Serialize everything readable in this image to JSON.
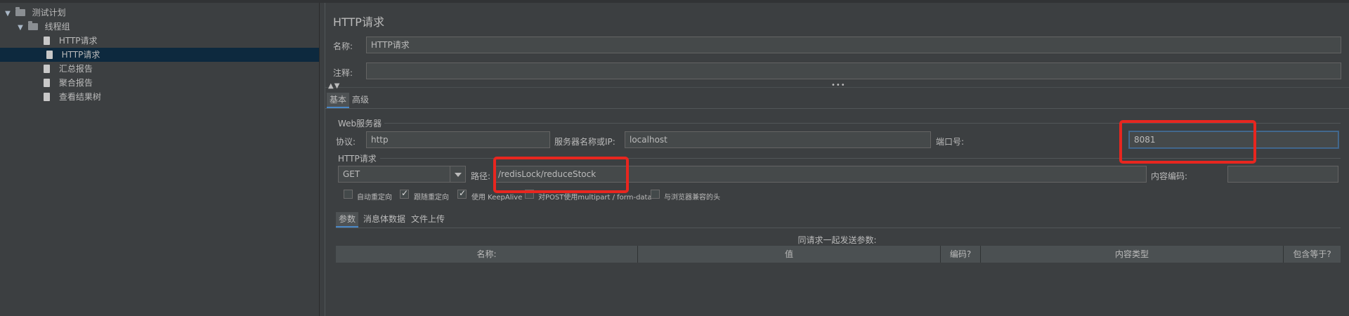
{
  "tree": {
    "items": [
      {
        "label": "测试计划"
      },
      {
        "label": "线程组"
      },
      {
        "label": "HTTP请求"
      },
      {
        "label": "HTTP请求"
      },
      {
        "label": "汇总报告"
      },
      {
        "label": "聚合报告"
      },
      {
        "label": "查看结果树"
      }
    ]
  },
  "panel": {
    "title": "HTTP请求",
    "name_label": "名称:",
    "name_value": "HTTP请求",
    "comment_label": "注释:",
    "comment_value": "",
    "tabs": [
      {
        "label": "基本"
      },
      {
        "label": "高级"
      }
    ]
  },
  "web_server": {
    "group_label": "Web服务器",
    "protocol_label": "协议:",
    "protocol_value": "http",
    "server_label": "服务器名称或IP:",
    "server_value": "localhost",
    "port_label": "端口号:",
    "port_value": "8081"
  },
  "http_request": {
    "group_label": "HTTP请求",
    "method_value": "GET",
    "path_label": "路径:",
    "path_value": "/redisLock/reduceStock",
    "encoding_label": "内容编码:",
    "encoding_value": "",
    "options": [
      {
        "label": "自动重定向",
        "checked": false
      },
      {
        "label": "跟随重定向",
        "checked": true
      },
      {
        "label": "使用 KeepAlive",
        "checked": true
      },
      {
        "label": "对POST使用multipart / form-data",
        "checked": false
      },
      {
        "label": "与浏览器兼容的头",
        "checked": false
      }
    ]
  },
  "params": {
    "tabs": [
      {
        "label": "参数"
      },
      {
        "label": "消息体数据"
      },
      {
        "label": "文件上传"
      }
    ],
    "send_label": "同请求一起发送参数:",
    "columns": [
      {
        "label": "名称:"
      },
      {
        "label": "值"
      },
      {
        "label": "编码?"
      },
      {
        "label": "内容类型"
      },
      {
        "label": "包含等于?"
      }
    ]
  },
  "colors": {
    "background": "#3c3f41",
    "selected_row": "#0d293e",
    "highlight_box": "#e8261f",
    "active_tab_underline": "#4a88c7"
  }
}
